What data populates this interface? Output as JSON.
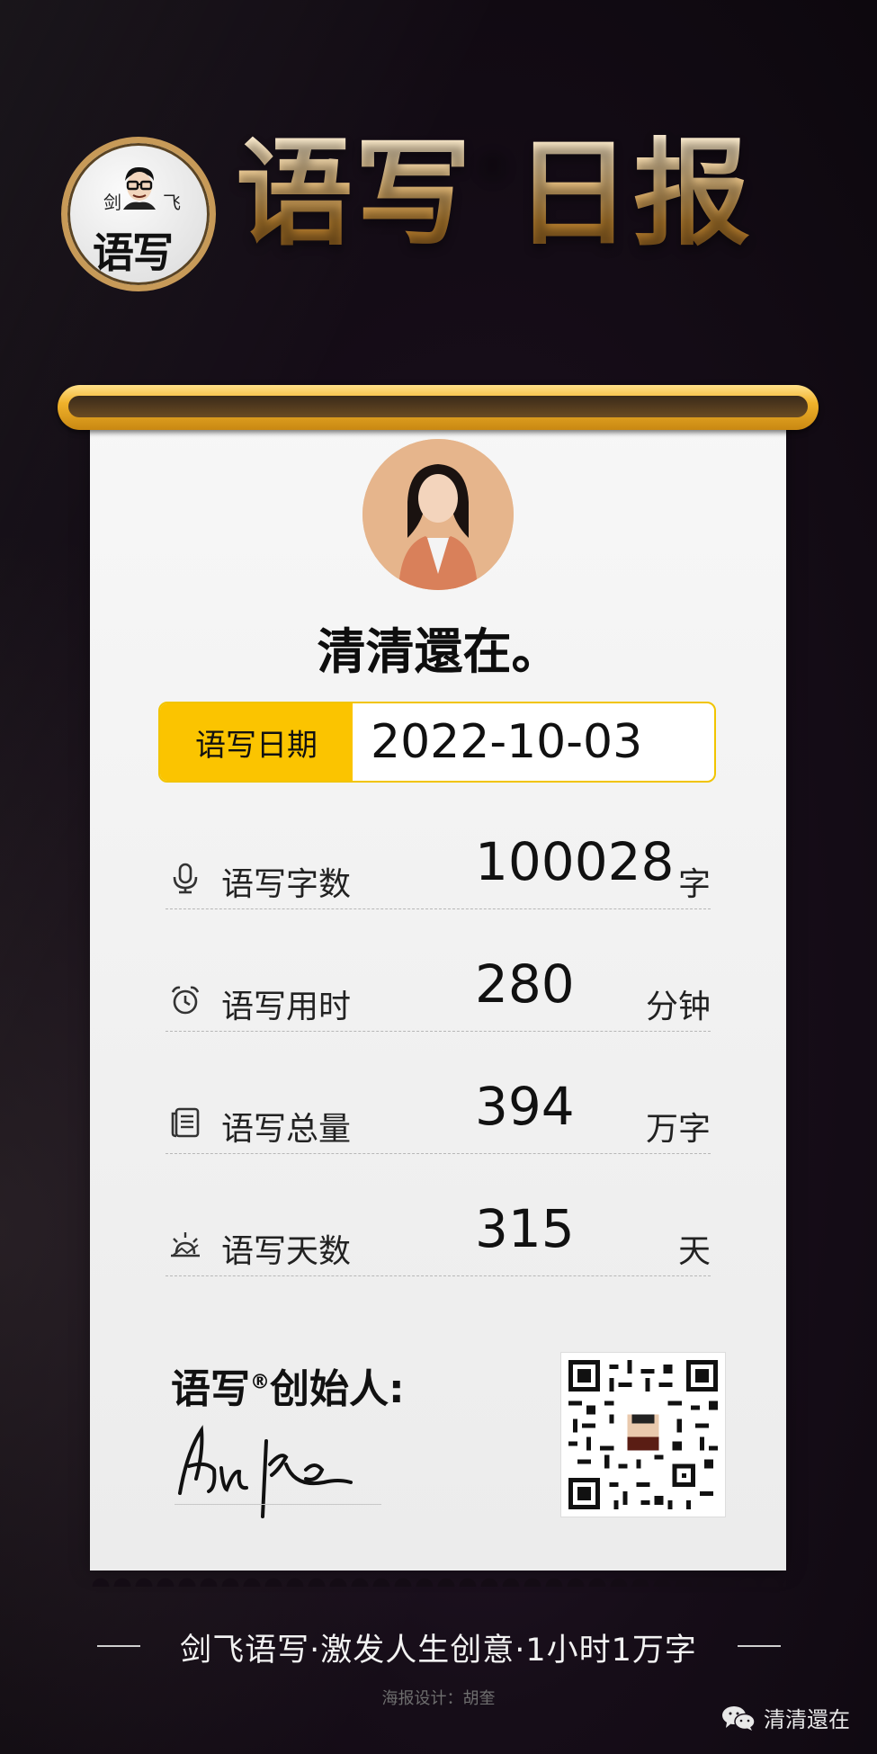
{
  "header": {
    "logo_char_left": "剑",
    "logo_char_right": "飞",
    "logo_main": "语写",
    "title_part1": "语写",
    "title_mark": "®",
    "title_part2": "日报"
  },
  "profile": {
    "username": "清清還在。"
  },
  "date": {
    "label": "语写日期",
    "value": "2022-10-03"
  },
  "stats": [
    {
      "icon": "microphone-icon",
      "label": "语写字数",
      "value": "100028",
      "unit": "字"
    },
    {
      "icon": "alarm-clock-icon",
      "label": "语写用时",
      "value": "280",
      "unit": "分钟"
    },
    {
      "icon": "document-icon",
      "label": "语写总量",
      "value": "394",
      "unit": "万字"
    },
    {
      "icon": "sunrise-icon",
      "label": "语写天数",
      "value": "315",
      "unit": "天"
    }
  ],
  "founder": {
    "label_part1": "语写",
    "label_mark": "®",
    "label_part2": "创始人:"
  },
  "footer": {
    "slogan": "剑飞语写·激发人生创意·1小时1万字",
    "designer": "海报设计：胡奎",
    "wechat_account": "清清還在"
  },
  "colors": {
    "accent_yellow": "#fbc400",
    "gold": "#c79a58",
    "background": "#160d18"
  }
}
